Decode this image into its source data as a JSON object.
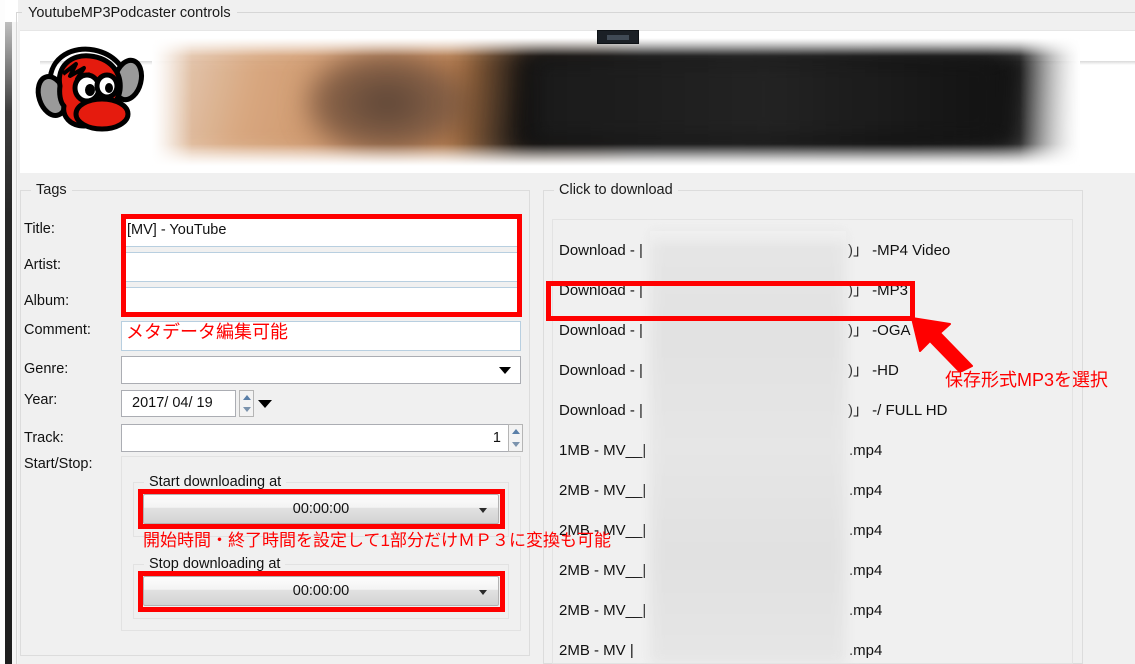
{
  "window": {
    "group_title": "YoutubeMP3Podcaster controls"
  },
  "banner": {
    "logo_name": "podcaster-mascot-logo"
  },
  "tags": {
    "group_title": "Tags",
    "labels": {
      "title": "Title:",
      "artist": "Artist:",
      "album": "Album:",
      "comment": "Comment:",
      "genre": "Genre:",
      "year": "Year:",
      "track": "Track:",
      "startstop": "Start/Stop:"
    },
    "values": {
      "title": "[MV]  - YouTube",
      "artist": "",
      "album": "",
      "comment": "",
      "genre": "",
      "year": "2017/ 04/ 19",
      "track": "1"
    },
    "startstop": {
      "start_group": "Start downloading at",
      "start_value": "00:00:00",
      "stop_group": "Stop downloading at",
      "stop_value": "00:00:00"
    }
  },
  "download": {
    "group_title": "Click to download",
    "rows": [
      {
        "prefix": "Download - |",
        "suffix": ")」 -MP4 Video"
      },
      {
        "prefix": "Download - |",
        "suffix": ")」 -MP3"
      },
      {
        "prefix": "Download - |",
        "suffix": ")」 -OGA"
      },
      {
        "prefix": "Download - |",
        "suffix": ")」 -HD"
      },
      {
        "prefix": "Download - |",
        "suffix": ")」 -/ FULL HD"
      },
      {
        "prefix": "1MB - MV__|",
        "suffix": ".mp4"
      },
      {
        "prefix": "2MB - MV__|",
        "suffix": ".mp4"
      },
      {
        "prefix": "2MB - MV__|",
        "suffix": ".mp4"
      },
      {
        "prefix": "2MB - MV__|",
        "suffix": ".mp4"
      },
      {
        "prefix": "2MB - MV__|",
        "suffix": ".mp4"
      },
      {
        "prefix": "2MB - MV   |",
        "suffix": ".mp4"
      }
    ]
  },
  "annotations": {
    "comment_note": "メタデータ編集可能",
    "time_note": "開始時間・終了時間を設定して1部分だけＭＰ３に変換も可能",
    "mp3_note": "保存形式MP3を選択",
    "color": "#ff0000"
  }
}
